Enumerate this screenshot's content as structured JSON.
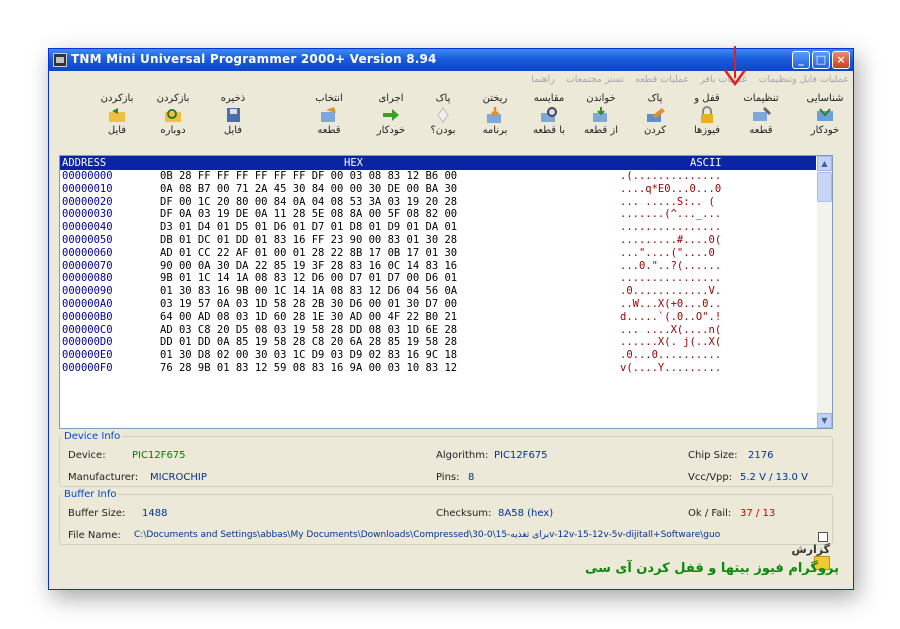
{
  "window": {
    "title": "TNM Mini Universal Programmer 2000+   Version 8.94"
  },
  "menu": [
    "عملیات فایل وتنظیمات",
    "عملیات بافر",
    "عملیات قطعه",
    "تستر مجتمعات",
    "راهنما"
  ],
  "toolbar": {
    "identify": {
      "top": "شناسایی",
      "bottom": "خودکار"
    },
    "settings": {
      "top": "تنظیمات",
      "bottom": "قطعه"
    },
    "lock_fuses": {
      "top": "قفل و",
      "bottom": "فیوزها"
    },
    "erase": {
      "top": "پاک",
      "bottom": "کردن"
    },
    "read": {
      "top": "خواندن",
      "bottom": "از قطعه"
    },
    "compare": {
      "top": "مقایسه",
      "bottom": "با قطعه"
    },
    "write": {
      "top": "ریختن",
      "bottom": "برنامه"
    },
    "blank": {
      "top": "پاک",
      "bottom": "بودن؟"
    },
    "auto_run": {
      "top": "اجرای",
      "bottom": "خودکار"
    },
    "select_chip": {
      "top": "انتخاب",
      "bottom": "قطعه"
    },
    "save_file": {
      "top": "ذخیره",
      "bottom": "فایل"
    },
    "reload": {
      "top": "بازکردن",
      "bottom": "دوباره"
    },
    "open_file": {
      "top": "بازکردن",
      "bottom": "فایل"
    }
  },
  "hex": {
    "headers": {
      "address": "ADDRESS",
      "hex": "HEX",
      "ascii": "ASCII"
    },
    "rows": [
      {
        "addr": "00000000",
        "hex": "0B 28 FF FF FF FF FF FF DF 00 03 08 83 12 B6 00",
        "ascii": ".(.............."
      },
      {
        "addr": "00000010",
        "hex": "0A 08 B7 00 71 2A 45 30 84 00 00 30 DE 00 BA 30",
        "ascii": "....q*E0...0...0"
      },
      {
        "addr": "00000020",
        "hex": "DF 00 1C 20 80 00 84 0A 04 08 53 3A 03 19 20 28",
        "ascii": "... .....S:.. ("
      },
      {
        "addr": "00000030",
        "hex": "DF 0A 03 19 DE 0A 11 28 5E 08 8A 00 5F 08 82 00",
        "ascii": ".......(^..._..."
      },
      {
        "addr": "00000040",
        "hex": "D3 01 D4 01 D5 01 D6 01 D7 01 D8 01 D9 01 DA 01",
        "ascii": "................"
      },
      {
        "addr": "00000050",
        "hex": "DB 01 DC 01 DD 01 83 16 FF 23 90 00 83 01 30 28",
        "ascii": ".........#....0("
      },
      {
        "addr": "00000060",
        "hex": "AD 01 CC 22 AF 01 00 01 28 22 8B 17 0B 17 01 30",
        "ascii": "...\"....(\"....0"
      },
      {
        "addr": "00000070",
        "hex": "90 00 0A 30 DA 22 85 19 3F 28 83 16 0C 14 83 16",
        "ascii": "...0.\"..?(......"
      },
      {
        "addr": "00000080",
        "hex": "9B 01 1C 14 1A 08 83 12 D6 00 D7 01 D7 00 D6 01",
        "ascii": "................"
      },
      {
        "addr": "00000090",
        "hex": "01 30 83 16 9B 00 1C 14 1A 08 83 12 D6 04 56 0A",
        "ascii": ".0............V."
      },
      {
        "addr": "000000A0",
        "hex": "03 19 57 0A 03 1D 58 28 2B 30 D6 00 01 30 D7 00",
        "ascii": "..W...X(+0...0.."
      },
      {
        "addr": "000000B0",
        "hex": "64 00 AD 08 03 1D 60 28 1E 30 AD 00 4F 22 B0 21",
        "ascii": "d.....`(.0..O\".!"
      },
      {
        "addr": "000000C0",
        "hex": "AD 03 C8 20 D5 08 03 19 58 28 DD 08 03 1D 6E 28",
        "ascii": "... ....X(....n("
      },
      {
        "addr": "000000D0",
        "hex": "DD 01 DD 0A 85 19 58 28 C8 20 6A 28 85 19 58 28",
        "ascii": "......X(. j(..X("
      },
      {
        "addr": "000000E0",
        "hex": "01 30 D8 02 00 30 03 1C D9 03 D9 02 83 16 9C 18",
        "ascii": ".0...0.........."
      },
      {
        "addr": "000000F0",
        "hex": "76 28 9B 01 83 12 59 08 83 16 9A 00 03 10 83 12",
        "ascii": "v(....Y........."
      }
    ]
  },
  "device_info": {
    "legend": "Device Info",
    "device_label": "Device:",
    "device": "PIC12F675",
    "algorithm_label": "Algorithm:",
    "algorithm": "PIC12F675",
    "chip_size_label": "Chip Size:",
    "chip_size": "2176",
    "manufacturer_label": "Manufacturer:",
    "manufacturer": "MICROCHIP",
    "pins_label": "Pins:",
    "pins": "8",
    "vcc_label": "Vcc/Vpp:",
    "vcc": "5.2 V / 13.0 V"
  },
  "buffer_info": {
    "legend": "Buffer Info",
    "buffer_size_label": "Buffer Size:",
    "buffer_size": "1488",
    "checksum_label": "Checksum:",
    "checksum": "8A58 (hex)",
    "okfail_label": "Ok / Fail:",
    "okfail": "37 / 13",
    "filename_label": "File Name:",
    "filename": "C:\\Documents and Settings\\abbas\\My Documents\\Downloads\\Compressed\\30-0\\برای تغذیه-15v-12v-15-12v-5v-dijitall+Software\\guo",
    "report_label": "گزارش"
  },
  "caption": "پروگرام فیوز بیتها و قفل کردن آی سی"
}
